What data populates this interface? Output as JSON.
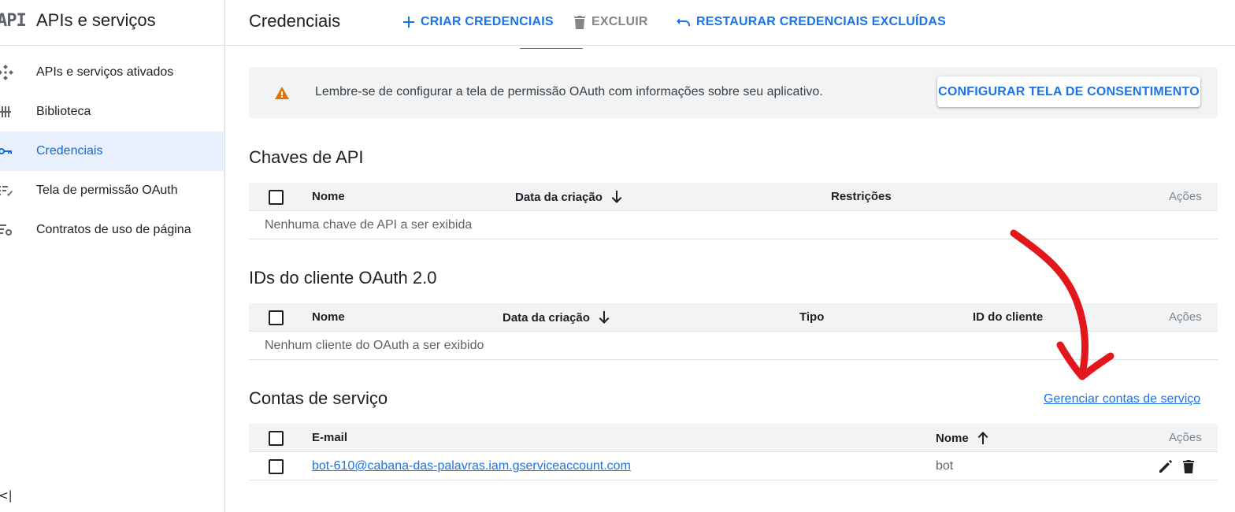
{
  "sidebar": {
    "logo": "API",
    "title": "APIs e serviços",
    "items": [
      {
        "label": "APIs e serviços ativados",
        "icon": "diamond-dots-icon"
      },
      {
        "label": "Biblioteca",
        "icon": "library-icon"
      },
      {
        "label": "Credenciais",
        "icon": "key-icon",
        "active": true
      },
      {
        "label": "Tela de permissão OAuth",
        "icon": "consent-screen-icon"
      },
      {
        "label": "Contratos de uso de página",
        "icon": "settings-list-icon"
      }
    ],
    "collapse_glyph": "<|"
  },
  "header": {
    "title": "Credenciais",
    "create_label": "CRIAR CREDENCIAIS",
    "delete_label": "EXCLUIR",
    "restore_label": "RESTAURAR CREDENCIAIS EXCLUÍDAS"
  },
  "banner": {
    "message": "Lembre-se de configurar a tela de permissão OAuth com informações sobre seu aplicativo.",
    "button_label": "CONFIGURAR TELA DE CONSENTIMENTO"
  },
  "api_keys": {
    "title": "Chaves de API",
    "columns": [
      "Nome",
      "Data da criação",
      "Restrições",
      "Ações"
    ],
    "empty_text": "Nenhuma chave de API a ser exibida"
  },
  "oauth_clients": {
    "title": "IDs do cliente OAuth 2.0",
    "columns": [
      "Nome",
      "Data da criação",
      "Tipo",
      "ID do cliente",
      "Ações"
    ],
    "empty_text": "Nenhum cliente do OAuth a ser exibido"
  },
  "service_accounts": {
    "title": "Contas de serviço",
    "manage_link": "Gerenciar contas de serviço",
    "columns": [
      "E-mail",
      "Nome",
      "Ações"
    ],
    "rows": [
      {
        "email": "bot-610@cabana-das-palavras.iam.gserviceaccount.com",
        "name": "bot"
      }
    ]
  },
  "colors": {
    "accent": "#1a73e8",
    "active_bg": "#e8f0fe",
    "warning": "#e37400",
    "annotation": "#e2171c"
  }
}
